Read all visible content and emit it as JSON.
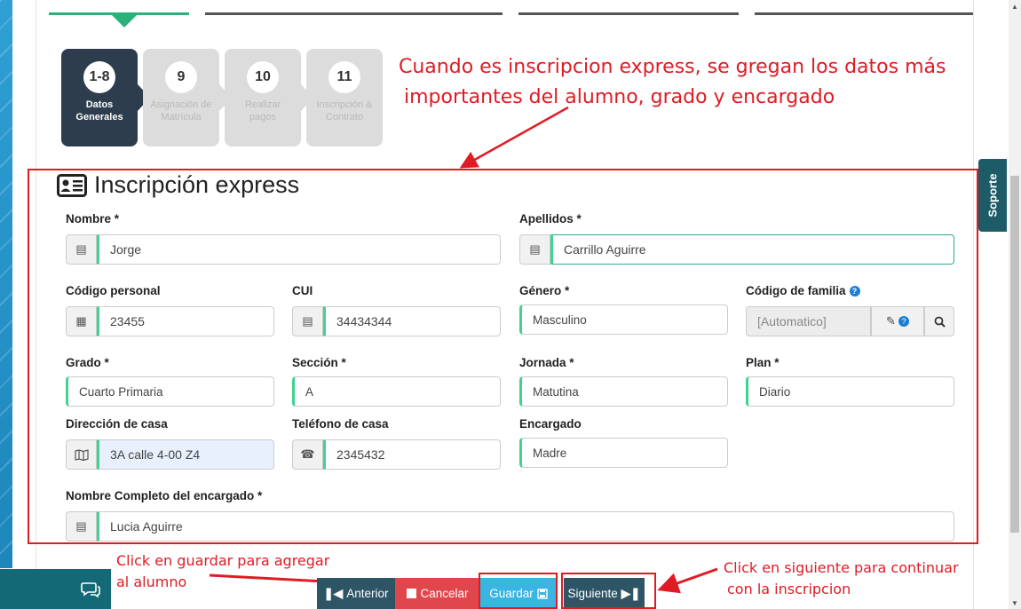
{
  "steps": [
    {
      "num": "1-8",
      "label_line1": "Datos",
      "label_line2": "Generales"
    },
    {
      "num": "9",
      "label_line1": "Asignación de",
      "label_line2": "Matrícula"
    },
    {
      "num": "10",
      "label_line1": "Realizar",
      "label_line2": "pagos"
    },
    {
      "num": "11",
      "label_line1": "Inscripción &",
      "label_line2": "Contrato"
    }
  ],
  "annotations": {
    "top_line1": "Cuando es inscripcion express, se gregan los datos más",
    "top_line2": "importantes del alumno, grado y encargado",
    "guardar_line1": "Click en guardar para agregar",
    "guardar_line2": "al alumno",
    "siguiente_line1": "Click en siguiente para continuar",
    "siguiente_line2": "con la inscripcion"
  },
  "form": {
    "title": "Inscripción express",
    "nombre_label": "Nombre *",
    "nombre_value": "Jorge",
    "apellidos_label": "Apellidos *",
    "apellidos_value": "Carrillo Aguirre",
    "codigo_personal_label": "Código personal",
    "codigo_personal_value": "23455",
    "cui_label": "CUI",
    "cui_value": "34434344",
    "genero_label": "Género *",
    "genero_value": "Masculino",
    "codigo_familia_label": "Código de familia",
    "codigo_familia_value": "[Automatico]",
    "grado_label": "Grado *",
    "grado_value": "Cuarto Primaria",
    "seccion_label": "Sección *",
    "seccion_value": "A",
    "jornada_label": "Jornada *",
    "jornada_value": "Matutina",
    "plan_label": "Plan *",
    "plan_value": "Diario",
    "direccion_label": "Dirección de casa",
    "direccion_value": "3A calle 4-00 Z4",
    "telefono_label": "Teléfono de casa",
    "telefono_value": "2345432",
    "encargado_label": "Encargado",
    "encargado_value": "Madre",
    "nombre_encargado_label": "Nombre Completo del encargado *",
    "nombre_encargado_value": "Lucia Aguirre"
  },
  "support_label": "Soporte",
  "buttons": {
    "anterior": "Anterior",
    "cancelar": "Cancelar",
    "guardar": "Guardar",
    "siguiente": "Siguiente"
  },
  "colors": {
    "annotation_red": "#e01b24",
    "step_active": "#2d3d4d",
    "input_accent": "#3fd290",
    "btn_anterior": "#2d5566",
    "btn_cancelar": "#e0474c",
    "btn_guardar": "#3ab4e0",
    "btn_siguiente": "#2d5566"
  }
}
